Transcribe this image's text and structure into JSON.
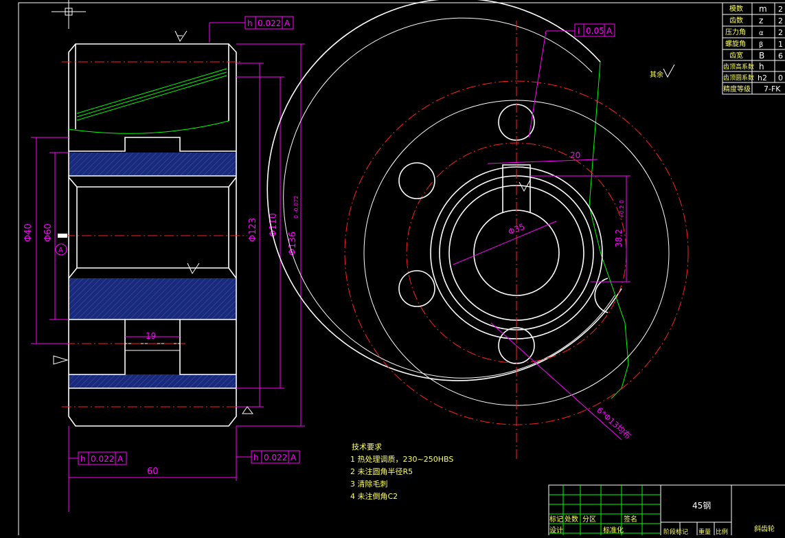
{
  "drawing": {
    "dims": {
      "left_width": "60",
      "bore": "Φ40",
      "hub": "Φ60",
      "d123": "Φ123",
      "d110": "Φ110",
      "d136": "Φ136",
      "d136_tol": "0 -0.072",
      "keyway": "19",
      "key_width": "20",
      "bore_right": "Φ35",
      "key_depth": "38.2",
      "key_depth_tol": "+0.2 0",
      "holes": "6*Φ13均布"
    },
    "datum": "A",
    "tolerances": {
      "top_left": {
        "symbol": "h",
        "value": "0.022",
        "datum": "A"
      },
      "bottom_left": {
        "symbol": "h",
        "value": "0.022",
        "datum": "A"
      },
      "bottom_right": {
        "symbol": "h",
        "value": "0.022",
        "datum": "A"
      },
      "right_top": {
        "symbol": "i",
        "value": "0.05",
        "datum": "A"
      }
    },
    "roughness_note": "其余",
    "tech_requirements": {
      "title": "技术要求",
      "items": [
        "1  热处理调质，230~250HBS",
        "2  未注圆角半径R5",
        "3  清除毛刺",
        "4  未注倒角C2"
      ]
    }
  },
  "param_table": {
    "rows": [
      {
        "name": "模数",
        "symbol": "m",
        "value": "2"
      },
      {
        "name": "齿数",
        "symbol": "z",
        "value": "2"
      },
      {
        "name": "压力角",
        "symbol": "α",
        "value": "2"
      },
      {
        "name": "螺旋角",
        "symbol": "β",
        "value": "1"
      },
      {
        "name": "齿宽",
        "symbol": "B",
        "value": "6"
      },
      {
        "name": "齿顶高系数",
        "symbol": "h",
        "value": ""
      },
      {
        "name": "齿顶圆系数",
        "symbol": "h2",
        "value": "0"
      },
      {
        "name": "精度等级",
        "symbol": "",
        "value": "7-FK"
      }
    ]
  },
  "title_block": {
    "material": "45钢",
    "part_name": "斜齿轮",
    "labels": {
      "mark": "标记",
      "count": "处数",
      "zone": "分区",
      "sign": "签名",
      "design": "设计",
      "standard": "标准化",
      "stage": "阶段标记",
      "weight": "重量",
      "scale": "比例"
    }
  },
  "colors": {
    "background": "#000000",
    "outline": "#ffffff",
    "centerline": "#ff2020",
    "dimension": "#ff00ff",
    "break_line": "#00ff00",
    "note_text": "#ffff66",
    "section_fill": "#1a2a7a"
  }
}
